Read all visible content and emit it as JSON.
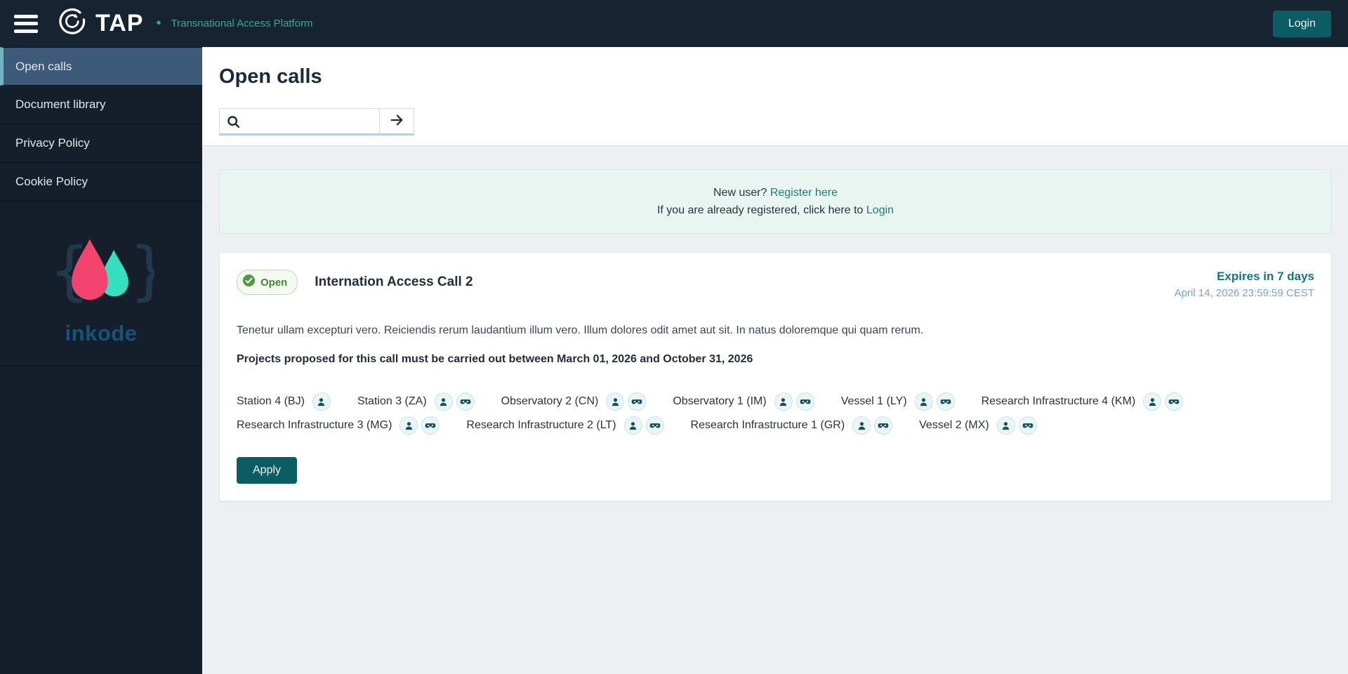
{
  "header": {
    "brand": "TAP",
    "separator": "•",
    "subtitle": "Transnational Access Platform",
    "login_label": "Login"
  },
  "sidebar": {
    "items": [
      {
        "label": "Open calls",
        "active": true
      },
      {
        "label": "Document library",
        "active": false
      },
      {
        "label": "Privacy Policy",
        "active": false
      },
      {
        "label": "Cookie Policy",
        "active": false
      }
    ],
    "logo_text": "inkode"
  },
  "main": {
    "title": "Open calls",
    "search": {
      "value": "",
      "placeholder": ""
    },
    "banner": {
      "line1_prefix": "New user?",
      "line1_link": "Register here",
      "line2_prefix": "If you are already registered, click here to",
      "line2_link": "Login"
    },
    "call": {
      "status": "Open",
      "title": "Internation Access Call 2",
      "expires": "Expires in 7 days",
      "expires_date": "April 14, 2026 23:59:59 CEST",
      "description": "Tenetur ullam excepturi vero. Reiciendis rerum laudantium illum vero. Illum dolores odit amet aut sit. In natus doloremque qui quam rerum.",
      "period_note": "Projects proposed for this call must be carried out between March 01, 2026 and October 31, 2026",
      "infrastructures": [
        {
          "name": "Station 4 (BJ)",
          "physical": true,
          "remote": false
        },
        {
          "name": "Station 3 (ZA)",
          "physical": true,
          "remote": true
        },
        {
          "name": "Observatory 2 (CN)",
          "physical": true,
          "remote": true
        },
        {
          "name": "Observatory 1 (IM)",
          "physical": true,
          "remote": true
        },
        {
          "name": "Vessel 1 (LY)",
          "physical": true,
          "remote": true
        },
        {
          "name": "Research Infrastructure 4 (KM)",
          "physical": true,
          "remote": true
        },
        {
          "name": "Research Infrastructure 3 (MG)",
          "physical": true,
          "remote": true
        },
        {
          "name": "Research Infrastructure 2 (LT)",
          "physical": true,
          "remote": true
        },
        {
          "name": "Research Infrastructure 1 (GR)",
          "physical": true,
          "remote": true
        },
        {
          "name": "Vessel 2 (MX)",
          "physical": true,
          "remote": true
        }
      ],
      "apply_label": "Apply"
    }
  },
  "colors": {
    "header_bg": "#162330",
    "sidebar_bg": "#141f2b",
    "active_item_bg": "#3d5a78",
    "active_item_accent": "#72b5c2",
    "teal_accent": "#35a79c",
    "button_teal": "#0a5d63",
    "link_teal": "#217c74",
    "banner_bg": "#e8f5f1",
    "badge_green": "#4f9a45",
    "expires_teal": "#15767d",
    "expires_date_blue": "#76a4cd",
    "logo_pink": "#f4436f",
    "logo_mint": "#35e0c0"
  }
}
